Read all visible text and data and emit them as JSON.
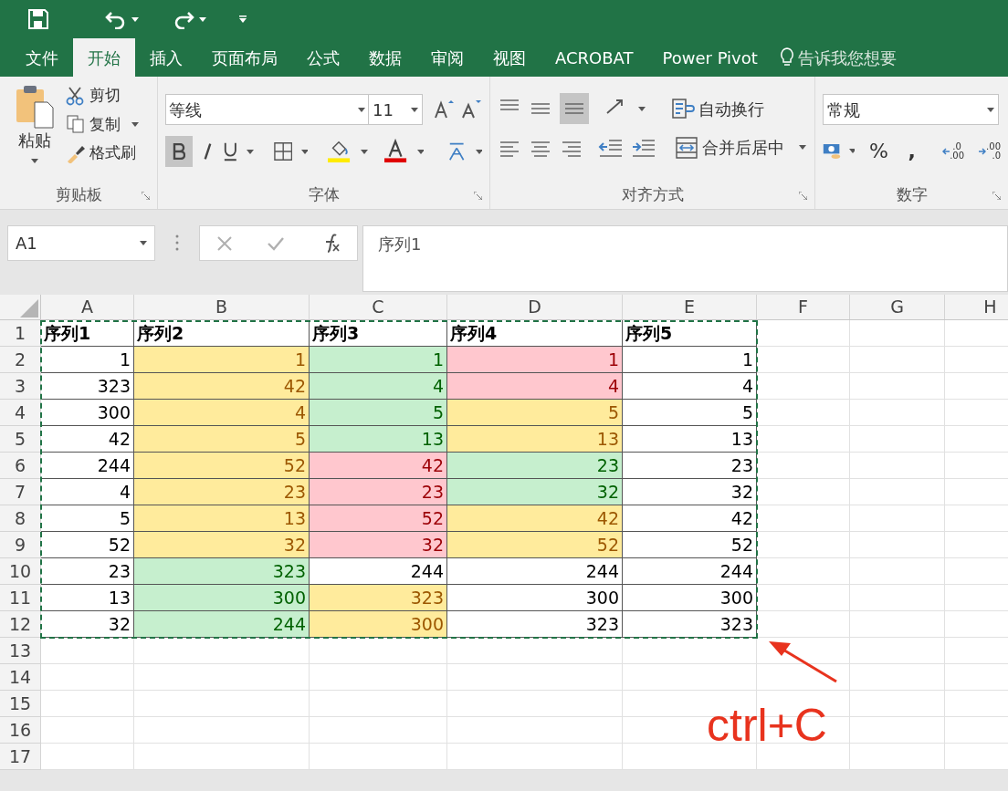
{
  "tabs": [
    {
      "label": "文件",
      "selected": false
    },
    {
      "label": "开始",
      "selected": true
    },
    {
      "label": "插入",
      "selected": false
    },
    {
      "label": "页面布局",
      "selected": false
    },
    {
      "label": "公式",
      "selected": false
    },
    {
      "label": "数据",
      "selected": false
    },
    {
      "label": "审阅",
      "selected": false
    },
    {
      "label": "视图",
      "selected": false
    },
    {
      "label": "ACROBAT",
      "selected": false
    },
    {
      "label": "Power Pivot",
      "selected": false
    }
  ],
  "tell_me": {
    "placeholder": "告诉我您想要"
  },
  "ribbon": {
    "clipboard": {
      "label": "剪贴板",
      "paste": "粘贴",
      "cut": "剪切",
      "copy": "复制",
      "format_painter": "格式刷"
    },
    "font": {
      "label": "字体",
      "font_name": "等线",
      "font_size": "11",
      "bold": true
    },
    "alignment": {
      "label": "对齐方式",
      "wrap_text": "自动换行",
      "merge_center": "合并后居中",
      "bottom_align": true
    },
    "number": {
      "label": "数字",
      "format": "常规",
      "percent": "%",
      "comma": ",",
      "increase_decimal": [
        ".0",
        ".00"
      ],
      "decrease_decimal": [
        ".00",
        ".0"
      ]
    }
  },
  "formula_bar": {
    "name_box": "A1",
    "formula": "序列1"
  },
  "sheet": {
    "columns": [
      "A",
      "B",
      "C",
      "D",
      "E",
      "F",
      "G",
      "H"
    ],
    "copy_marquee": true,
    "rows": [
      {
        "number": "1",
        "kind": "header",
        "cells": [
          {
            "text": "序列1"
          },
          {
            "text": "序列2"
          },
          {
            "text": "序列3"
          },
          {
            "text": "序列4"
          },
          {
            "text": "序列5"
          }
        ]
      },
      {
        "number": "2",
        "kind": "data",
        "cells": [
          {
            "text": "1"
          },
          {
            "text": "1",
            "color": "#ffeb9c"
          },
          {
            "text": "1",
            "color": "#c6efce"
          },
          {
            "text": "1",
            "color": "#ffc7ce"
          },
          {
            "text": "1"
          }
        ]
      },
      {
        "number": "3",
        "kind": "data",
        "cells": [
          {
            "text": "323"
          },
          {
            "text": "42",
            "color": "#ffeb9c"
          },
          {
            "text": "4",
            "color": "#c6efce"
          },
          {
            "text": "4",
            "color": "#ffc7ce"
          },
          {
            "text": "4"
          }
        ]
      },
      {
        "number": "4",
        "kind": "data",
        "cells": [
          {
            "text": "300"
          },
          {
            "text": "4",
            "color": "#ffeb9c"
          },
          {
            "text": "5",
            "color": "#c6efce"
          },
          {
            "text": "5",
            "color": "#ffeb9c"
          },
          {
            "text": "5"
          }
        ]
      },
      {
        "number": "5",
        "kind": "data",
        "cells": [
          {
            "text": "42"
          },
          {
            "text": "5",
            "color": "#ffeb9c"
          },
          {
            "text": "13",
            "color": "#c6efce"
          },
          {
            "text": "13",
            "color": "#ffeb9c"
          },
          {
            "text": "13"
          }
        ]
      },
      {
        "number": "6",
        "kind": "data",
        "cells": [
          {
            "text": "244"
          },
          {
            "text": "52",
            "color": "#ffeb9c"
          },
          {
            "text": "42",
            "color": "#ffc7ce"
          },
          {
            "text": "23",
            "color": "#c6efce"
          },
          {
            "text": "23"
          }
        ]
      },
      {
        "number": "7",
        "kind": "data",
        "cells": [
          {
            "text": "4"
          },
          {
            "text": "23",
            "color": "#ffeb9c"
          },
          {
            "text": "23",
            "color": "#ffc7ce"
          },
          {
            "text": "32",
            "color": "#c6efce"
          },
          {
            "text": "32"
          }
        ]
      },
      {
        "number": "8",
        "kind": "data",
        "cells": [
          {
            "text": "5"
          },
          {
            "text": "13",
            "color": "#ffeb9c"
          },
          {
            "text": "52",
            "color": "#ffc7ce"
          },
          {
            "text": "42",
            "color": "#ffeb9c"
          },
          {
            "text": "42"
          }
        ]
      },
      {
        "number": "9",
        "kind": "data",
        "cells": [
          {
            "text": "52"
          },
          {
            "text": "32",
            "color": "#ffeb9c"
          },
          {
            "text": "32",
            "color": "#ffc7ce"
          },
          {
            "text": "52",
            "color": "#ffeb9c"
          },
          {
            "text": "52"
          }
        ]
      },
      {
        "number": "10",
        "kind": "data",
        "cells": [
          {
            "text": "23"
          },
          {
            "text": "323",
            "color": "#c6efce"
          },
          {
            "text": "244"
          },
          {
            "text": "244"
          },
          {
            "text": "244"
          }
        ]
      },
      {
        "number": "11",
        "kind": "data",
        "cells": [
          {
            "text": "13"
          },
          {
            "text": "300",
            "color": "#c6efce"
          },
          {
            "text": "323",
            "color": "#ffeb9c"
          },
          {
            "text": "300"
          },
          {
            "text": "300"
          }
        ]
      },
      {
        "number": "12",
        "kind": "data",
        "cells": [
          {
            "text": "32"
          },
          {
            "text": "244",
            "color": "#c6efce"
          },
          {
            "text": "300",
            "color": "#ffeb9c"
          },
          {
            "text": "323"
          },
          {
            "text": "323"
          }
        ]
      },
      {
        "number": "13",
        "kind": "empty"
      },
      {
        "number": "14",
        "kind": "empty"
      },
      {
        "number": "15",
        "kind": "empty"
      },
      {
        "number": "16",
        "kind": "empty"
      },
      {
        "number": "17",
        "kind": "empty"
      }
    ]
  },
  "annotation": {
    "text": "ctrl+C"
  }
}
